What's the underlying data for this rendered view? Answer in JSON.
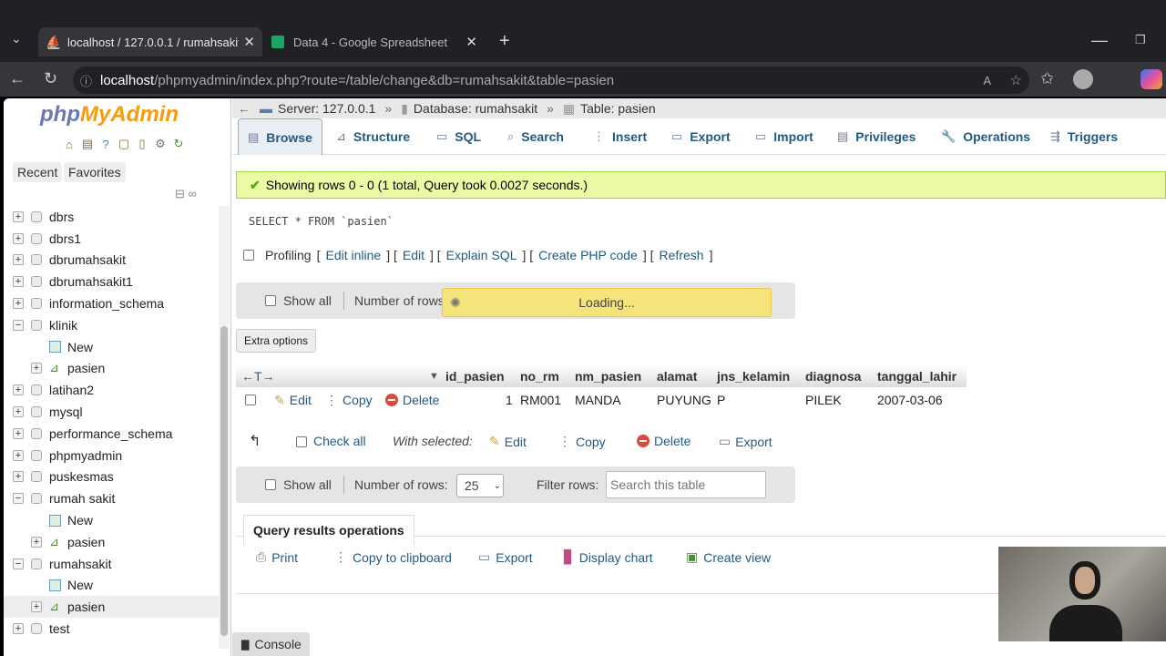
{
  "browser": {
    "tabs": [
      {
        "title": "localhost / 127.0.0.1 / rumahsakit / ...",
        "active": true
      },
      {
        "title": "Data 4 - Google Spreadsheet",
        "active": false
      }
    ],
    "url_host": "localhost",
    "url_path": "/phpmyadmin/index.php?route=/table/change&db=rumahsakit&table=pasien"
  },
  "sidebar": {
    "logo_php": "php",
    "logo_myadmin": "MyAdmin",
    "recent": "Recent",
    "favorites": "Favorites",
    "tree": [
      {
        "label": "dbrs",
        "level": 0,
        "exp": "+"
      },
      {
        "label": "dbrs1",
        "level": 0,
        "exp": "+"
      },
      {
        "label": "dbrumahsakit",
        "level": 0,
        "exp": "+"
      },
      {
        "label": "dbrumahsakit1",
        "level": 0,
        "exp": "+"
      },
      {
        "label": "information_schema",
        "level": 0,
        "exp": "+"
      },
      {
        "label": "klinik",
        "level": 0,
        "exp": "−"
      },
      {
        "label": "New",
        "level": 1,
        "type": "new"
      },
      {
        "label": "pasien",
        "level": 1,
        "type": "table"
      },
      {
        "label": "latihan2",
        "level": 0,
        "exp": "+"
      },
      {
        "label": "mysql",
        "level": 0,
        "exp": "+"
      },
      {
        "label": "performance_schema",
        "level": 0,
        "exp": "+"
      },
      {
        "label": "phpmyadmin",
        "level": 0,
        "exp": "+"
      },
      {
        "label": "puskesmas",
        "level": 0,
        "exp": "+"
      },
      {
        "label": "rumah sakit",
        "level": 0,
        "exp": "−"
      },
      {
        "label": "New",
        "level": 1,
        "type": "new"
      },
      {
        "label": "pasien",
        "level": 1,
        "type": "table"
      },
      {
        "label": "rumahsakit",
        "level": 0,
        "exp": "−"
      },
      {
        "label": "New",
        "level": 1,
        "type": "new"
      },
      {
        "label": "pasien",
        "level": 1,
        "type": "table",
        "selected": true
      },
      {
        "label": "test",
        "level": 0,
        "exp": "+"
      }
    ]
  },
  "breadcrumb": {
    "server": "Server: 127.0.0.1",
    "database": "Database: rumahsakit",
    "table": "Table: pasien"
  },
  "tabs": [
    "Browse",
    "Structure",
    "SQL",
    "Search",
    "Insert",
    "Export",
    "Import",
    "Privileges",
    "Operations",
    "Triggers"
  ],
  "success_message": "Showing rows 0 - 0 (1 total, Query took 0.0027 seconds.)",
  "sql_query": "SELECT * FROM `pasien`",
  "profiling": {
    "label": "Profiling",
    "links": [
      "Edit inline",
      "Edit",
      "Explain SQL",
      "Create PHP code",
      "Refresh"
    ]
  },
  "nav_top": {
    "show_all": "Show all",
    "number_of_rows": "Number of rows",
    "loading": "Loading..."
  },
  "extra_options": "Extra options",
  "table": {
    "columns": [
      "id_pasien",
      "no_rm",
      "nm_pasien",
      "alamat",
      "jns_kelamin",
      "diagnosa",
      "tanggal_lahir"
    ],
    "row_actions": [
      "Edit",
      "Copy",
      "Delete"
    ],
    "rows": [
      {
        "id_pasien": "1",
        "no_rm": "RM001",
        "nm_pasien": "MANDA",
        "alamat": "PUYUNG",
        "jns_kelamin": "P",
        "diagnosa": "PILEK",
        "tanggal_lahir": "2007-03-06"
      }
    ]
  },
  "with_selected": {
    "check_all": "Check all",
    "label": "With selected:",
    "edit": "Edit",
    "copy": "Copy",
    "delete": "Delete",
    "export": "Export"
  },
  "nav_bottom": {
    "show_all": "Show all",
    "number_of_rows": "Number of rows:",
    "rows_value": "25",
    "filter_rows": "Filter rows:",
    "search_placeholder": "Search this table"
  },
  "query_results": {
    "title": "Query results operations",
    "print": "Print",
    "copy_clipboard": "Copy to clipboard",
    "export": "Export",
    "display_chart": "Display chart",
    "create_view": "Create view"
  },
  "console": "Console"
}
